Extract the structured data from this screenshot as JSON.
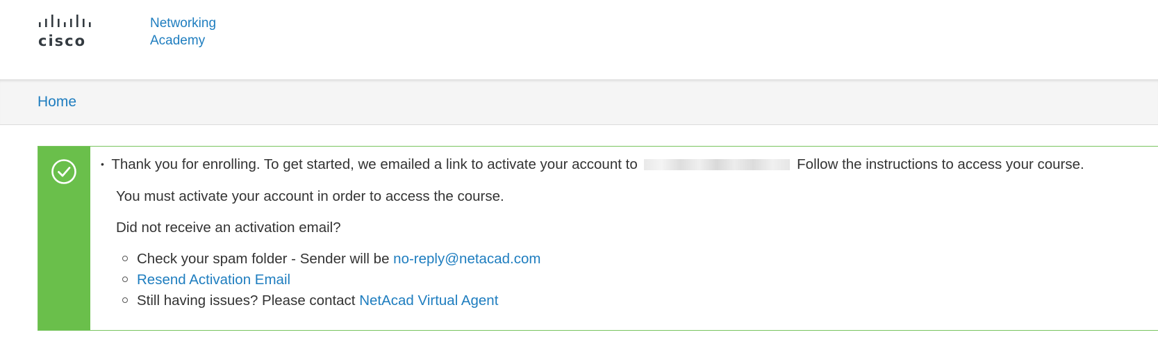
{
  "header": {
    "brand_word": "cisco",
    "academy_line1": "Networking",
    "academy_line2": "Academy"
  },
  "nav": {
    "home_label": "Home"
  },
  "alert": {
    "status_icon": "check-circle-icon",
    "accent_color": "#6abf4b",
    "line1_before": "Thank you for enrolling. To get started, we emailed a link to activate your account to",
    "line1_after": "Follow the instructions to access your course.",
    "line2": "You must activate your account in order to access the course.",
    "line3": "Did not receive an activation email?",
    "items": [
      {
        "text": "Check your spam folder - Sender will be ",
        "link": "no-reply@netacad.com"
      },
      {
        "text": "",
        "link": "Resend Activation Email"
      },
      {
        "text": "Still having issues? Please contact ",
        "link": "NetAcad Virtual Agent"
      }
    ]
  },
  "colors": {
    "link": "#1e7dbf",
    "text": "#333333",
    "alert_border": "#78c45e"
  }
}
